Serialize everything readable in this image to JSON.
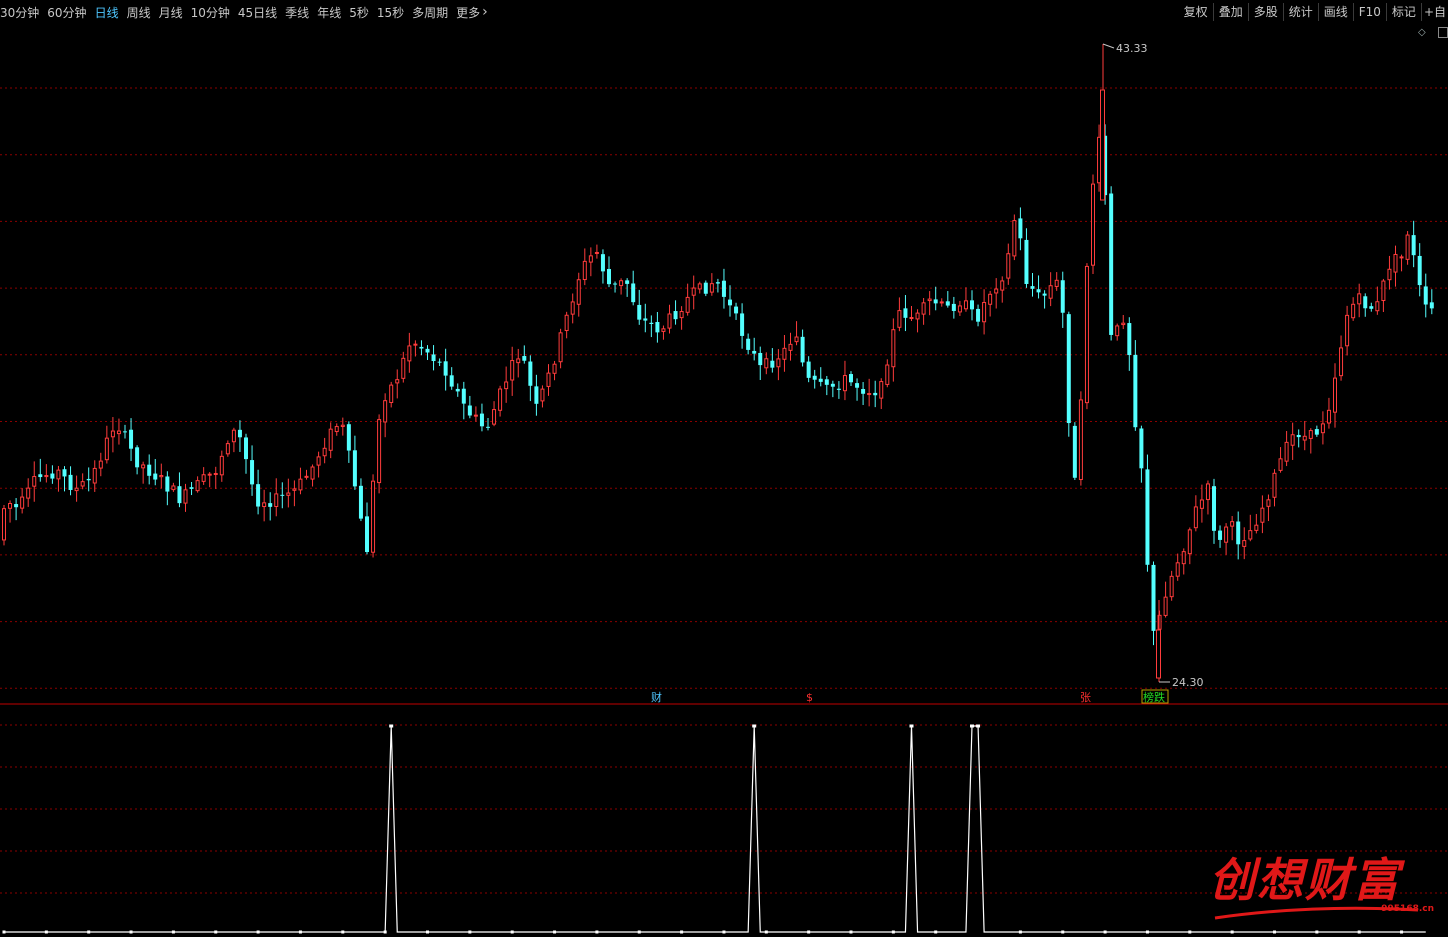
{
  "toolbar": {
    "periods": [
      "30分钟",
      "60分钟",
      "日线",
      "周线",
      "月线",
      "10分钟",
      "45日线",
      "季线",
      "年线",
      "5秒",
      "15秒",
      "多周期",
      "更多"
    ],
    "active_index": 2,
    "more_chevron": "chevron-right-icon",
    "right_buttons": [
      "复权",
      "叠加",
      "多股",
      "统计",
      "画线",
      "F10",
      "标记",
      "+自"
    ]
  },
  "chart_data": {
    "type": "candlestick",
    "high_label": "43.33",
    "low_label": "24.30",
    "colors": {
      "up": "#ff3c3c",
      "down": "#54ffff",
      "grid": "#8b0000",
      "indicator": "#ffffff"
    },
    "price_range": [
      24.3,
      43.33
    ],
    "markers": [
      {
        "text": "财",
        "color": "#4ec6ff"
      },
      {
        "text": "$",
        "color": "#ff3030"
      },
      {
        "text": "张",
        "color": "#ff3030"
      },
      {
        "text": "榜跌",
        "color": "#22dd22"
      }
    ],
    "indicator": {
      "type": "line",
      "spikes_at_bar": [
        64,
        124,
        150,
        160,
        161
      ],
      "range": [
        0,
        1
      ]
    }
  },
  "watermark": {
    "text": "创想财富",
    "url": "995168.cn"
  }
}
